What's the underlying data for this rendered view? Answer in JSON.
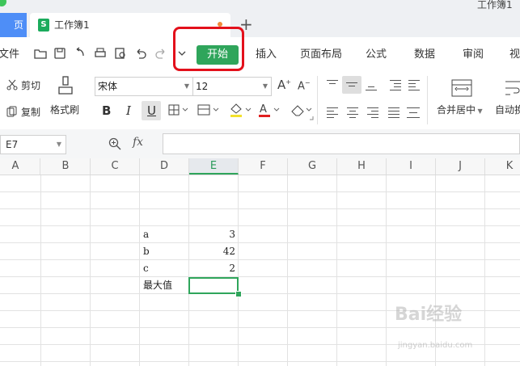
{
  "window": {
    "title": "工作簿1"
  },
  "tabs": {
    "home_label": "页",
    "book_label": "工作簿1",
    "book_icon_letter": "S"
  },
  "menu": {
    "file": "文件",
    "start": "开始",
    "insert": "插入",
    "page_layout": "页面布局",
    "formula": "公式",
    "data": "数据",
    "review": "审阅",
    "view": "视"
  },
  "ribbon": {
    "cut": "剪切",
    "copy": "复制",
    "format_painter": "格式刷",
    "font_name": "宋体",
    "font_size": "12",
    "bold": "B",
    "italic": "I",
    "underline": "U",
    "merge_center": "合并居中",
    "auto_wrap": "自动换"
  },
  "formula_bar": {
    "name_box": "E7",
    "fx": "fx",
    "content": ""
  },
  "sheet": {
    "columns": [
      "A",
      "B",
      "C",
      "D",
      "E",
      "F",
      "G",
      "H",
      "I",
      "J",
      "K"
    ],
    "active_column": "E",
    "rows": [
      {
        "label": "a",
        "value": "3"
      },
      {
        "label": "b",
        "value": "42"
      },
      {
        "label": "c",
        "value": "2"
      },
      {
        "label": "最大值",
        "value": ""
      }
    ],
    "selected_cell": "E7"
  },
  "watermark": {
    "text": "Bai经验",
    "sub": "jingyan.baidu.com"
  },
  "colors": {
    "accent": "#2fa55b",
    "highlight": "#e3101b",
    "tab_blue": "#4e8ef7"
  }
}
